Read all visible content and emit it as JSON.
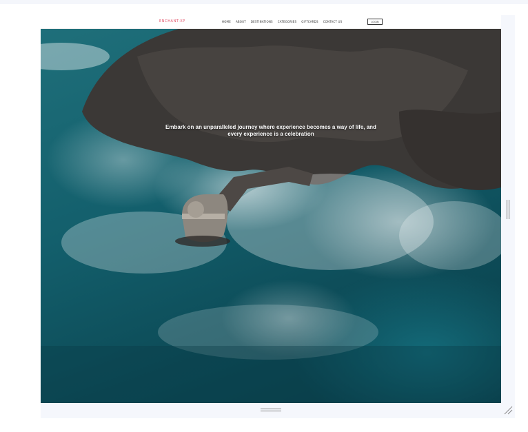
{
  "site": {
    "logo": "ENCHANT-XP",
    "nav_links": [
      "HOME",
      "ABOUT",
      "DESTINATIONS",
      "CATEGORIES",
      "GIFTCARDS",
      "CONTACT US"
    ],
    "nav_button": "LOGIN"
  },
  "hero": {
    "line1": "Embark on an unparalleled journey where experience becomes a way of life, and",
    "line2": "every experience is a celebration"
  },
  "colors": {
    "accent": "#e2536a",
    "ocean": "#135f6c",
    "rock": "#3b3836"
  },
  "icons": {
    "resize_right": "grip-vertical-icon",
    "resize_bottom": "grip-horizontal-icon",
    "resize_corner": "resize-corner-icon"
  }
}
